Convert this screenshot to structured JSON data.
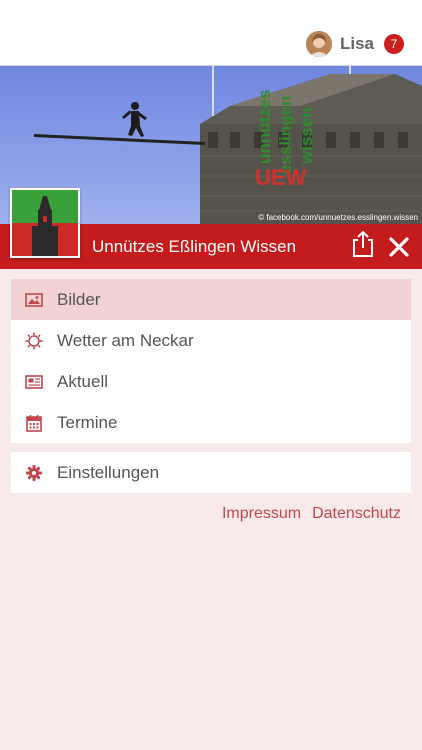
{
  "user": {
    "name": "Lisa",
    "notification_count": "7",
    "avatar_icon": "user-avatar-icon"
  },
  "hero": {
    "credit": "© facebook.com/unnuetzes.esslingen.wissen",
    "logo_lines": [
      "unnützes",
      "esslingen",
      "wissen"
    ],
    "logo_abbr": "UEW"
  },
  "app": {
    "title": "Unnützes Eßlingen Wissen"
  },
  "menu": {
    "items": [
      {
        "label": "Bilder",
        "icon": "image-icon",
        "active": true
      },
      {
        "label": "Wetter am Neckar",
        "icon": "sun-icon",
        "active": false
      },
      {
        "label": "Aktuell",
        "icon": "newspaper-icon",
        "active": false
      },
      {
        "label": "Termine",
        "icon": "calendar-icon",
        "active": false
      }
    ],
    "settings": {
      "label": "Einstellungen",
      "icon": "gear-icon"
    }
  },
  "footer": {
    "impressum": "Impressum",
    "datenschutz": "Datenschutz"
  },
  "colors": {
    "accent": "#c41c1c",
    "background": "#f8eaea",
    "active_row": "#f2d2d2",
    "icon": "#c0484e"
  }
}
